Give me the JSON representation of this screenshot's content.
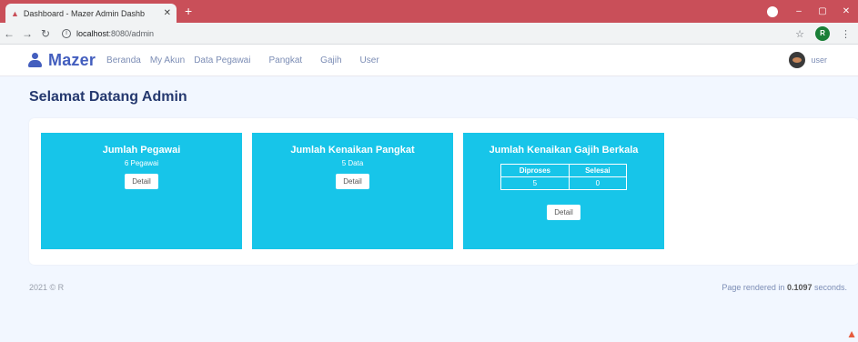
{
  "browser": {
    "tab_title": "Dashboard - Mazer Admin Dashb",
    "new_tab": "+",
    "url_host": "localhost",
    "url_path": ":8080/admin",
    "profile_initial": "R"
  },
  "navbar": {
    "brand": "Mazer",
    "items": [
      "Beranda",
      "My Akun",
      "Data Pegawai",
      "Pangkat",
      "Gajih",
      "User"
    ],
    "user_name": "user"
  },
  "page": {
    "title": "Selamat Datang Admin"
  },
  "cards": [
    {
      "title": "Jumlah Pegawai",
      "subtitle": "6 Pegawai",
      "button": "Detail"
    },
    {
      "title": "Jumlah Kenaikan Pangkat",
      "subtitle": "5 Data",
      "button": "Detail"
    },
    {
      "title": "Jumlah Kenaikan Gajih Berkala",
      "table_headers": [
        "Diproses",
        "Selesai"
      ],
      "table_values": [
        "5",
        "0"
      ],
      "button": "Detail"
    }
  ],
  "footer": {
    "copyright": "2021 © R",
    "render_prefix": "Page rendered in ",
    "render_time": "0.1097",
    "render_suffix": " seconds."
  },
  "colors": {
    "brand": "#435ebe",
    "card_bg": "#17c5e9",
    "tab_bar": "#c94f59"
  }
}
